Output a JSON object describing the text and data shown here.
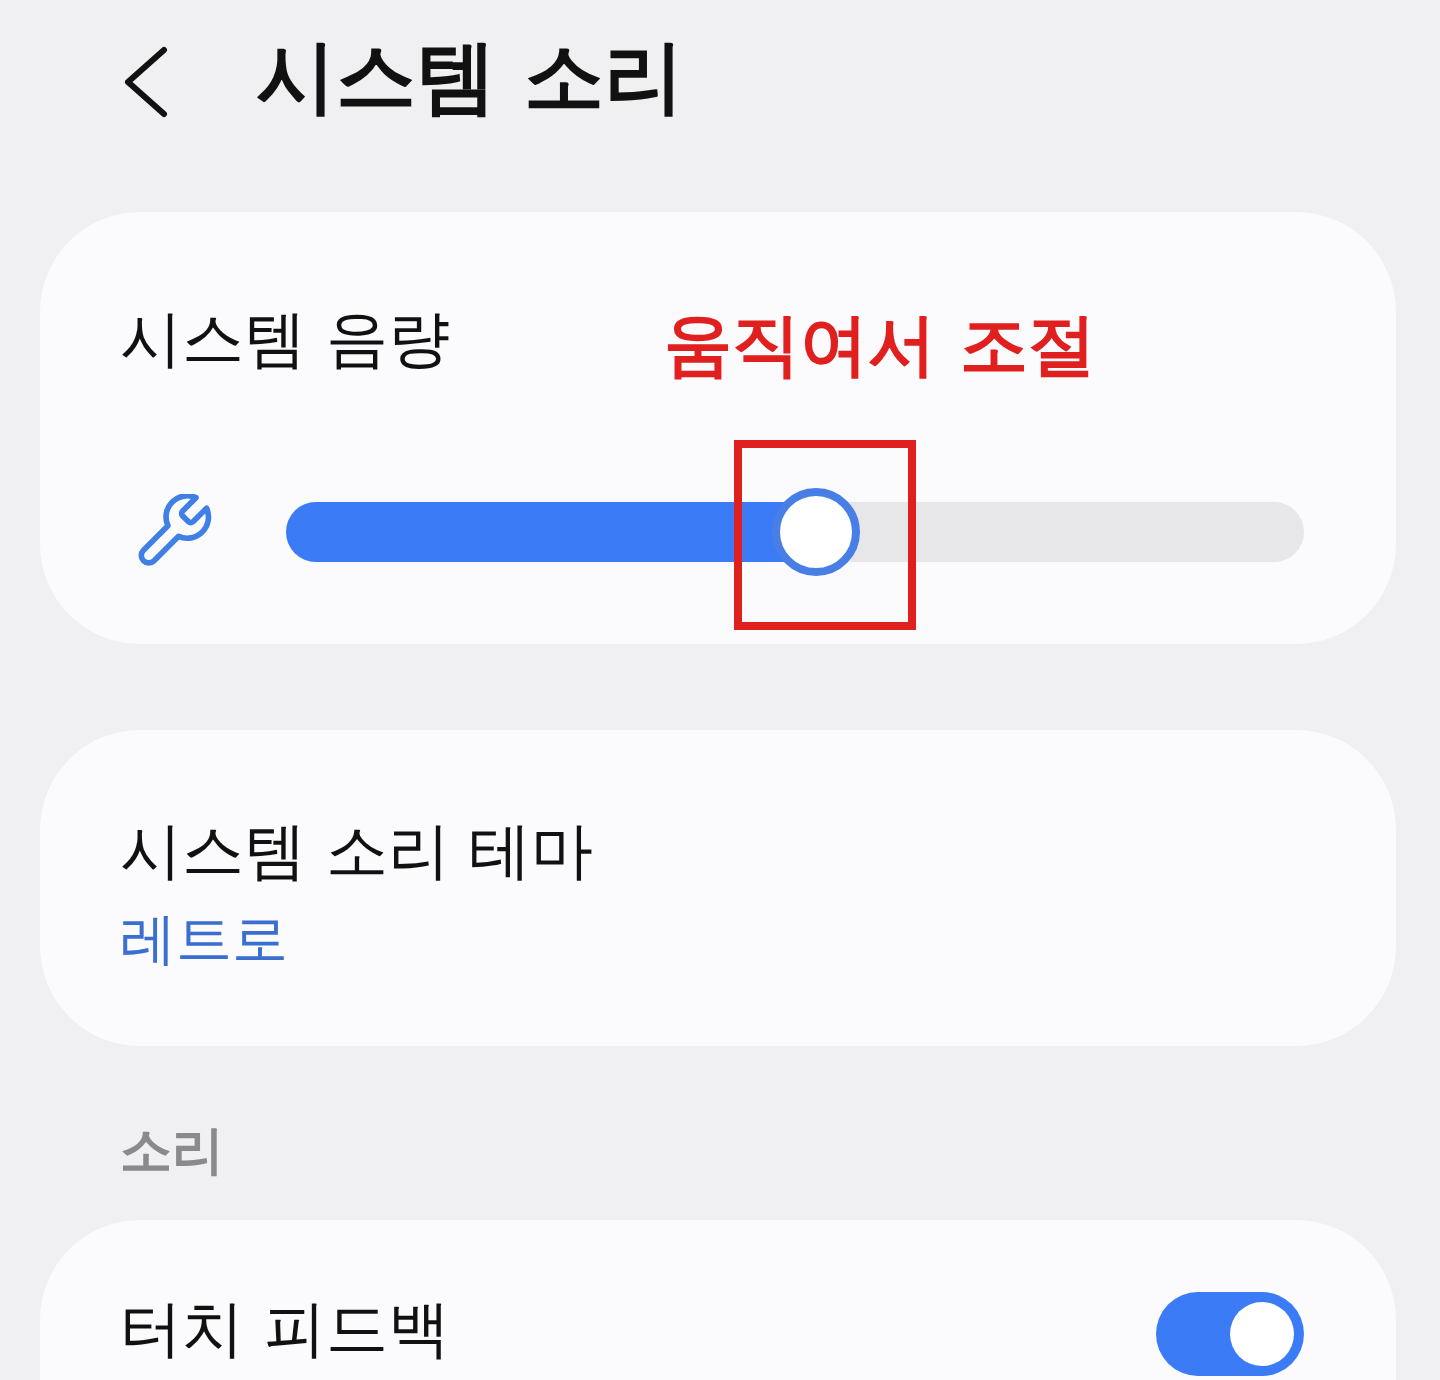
{
  "header": {
    "title": "시스템 소리"
  },
  "volume_card": {
    "title": "시스템 음량",
    "level": 0.52
  },
  "annotation": {
    "text": "움직여서 조절"
  },
  "theme_card": {
    "title": "시스템 소리 테마",
    "value": "레트로"
  },
  "section": {
    "title": "소리"
  },
  "items": [
    {
      "kind": "toggle",
      "label": "터치 피드백",
      "on": true
    }
  ]
}
